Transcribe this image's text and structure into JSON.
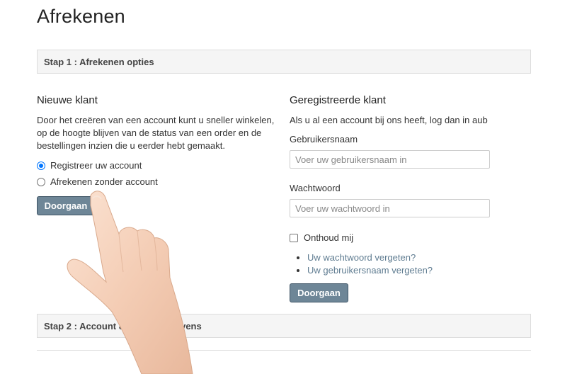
{
  "page": {
    "title": "Afrekenen"
  },
  "step1": {
    "label": "Stap 1 : Afrekenen opties"
  },
  "step2": {
    "label": "Stap 2 : Account & factuurgegevens"
  },
  "new_customer": {
    "heading": "Nieuwe klant",
    "description_lines": [
      "Door het creëren van een account kunt u sneller winkelen,",
      "op de hoogte blijven van de status van een order en de",
      "bestellingen inzien die u eerder hebt gemaakt."
    ],
    "options": [
      {
        "label": "Registreer uw account",
        "checked": true
      },
      {
        "label": "Afrekenen zonder account",
        "checked": false
      }
    ],
    "continue_label": "Doorgaan"
  },
  "registered_customer": {
    "heading": "Geregistreerde klant",
    "intro": "Als u al een account bij ons heeft, log dan in aub",
    "username_label": "Gebruikersnaam",
    "username_placeholder": "Voer uw gebruikersnaam in",
    "password_label": "Wachtwoord",
    "password_placeholder": "Voer uw wachtwoord in",
    "remember_label": "Onthoud mij",
    "remember_checked": false,
    "links": [
      "Uw wachtwoord vergeten?",
      "Uw gebruikersnaam vergeten?"
    ],
    "continue_label": "Doorgaan"
  },
  "colors": {
    "button": "#6e8697",
    "link": "#5f7c91",
    "radio_checked": "#0075ff",
    "panel_bg": "#f5f5f5"
  },
  "icons": {
    "pointing_hand": "pointing-hand-icon"
  }
}
